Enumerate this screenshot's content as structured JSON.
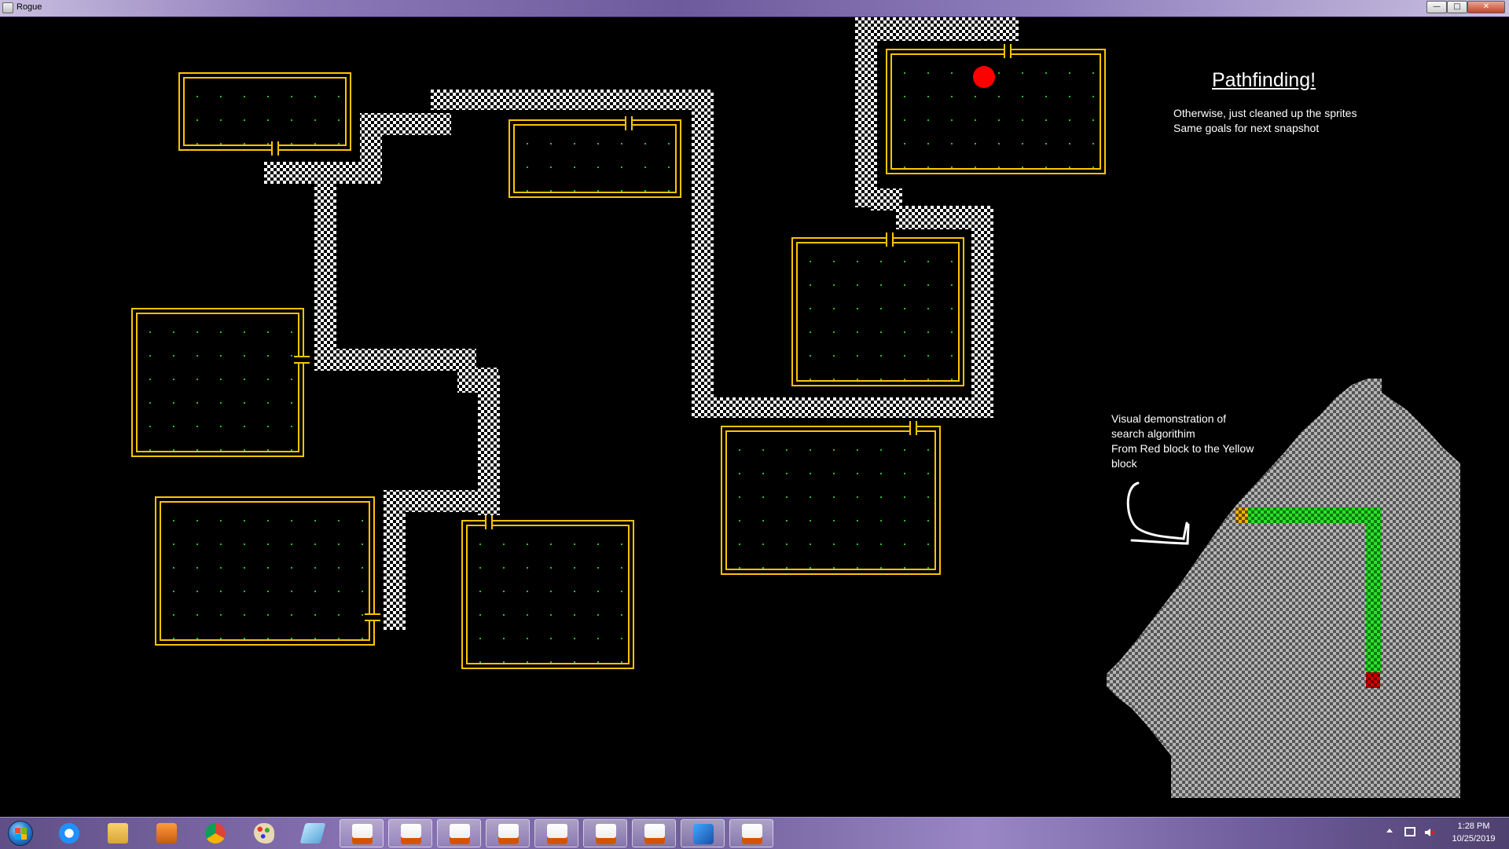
{
  "window": {
    "title": "Rogue",
    "icon": "java-window-icon"
  },
  "controls": {
    "minimize": "—",
    "maximize": "□",
    "close": "✕"
  },
  "overlay": {
    "heading": "Pathfinding!",
    "note_lines": [
      "Otherwise, just cleaned up the sprites",
      "Same goals for next snapshot"
    ],
    "visual_lines": [
      "Visual demonstration of",
      "search algorithim",
      "From Red block to the Yellow",
      "block"
    ]
  },
  "colors": {
    "room_wall": "#ffc400",
    "floor_dot": "#22c41a",
    "corridor_light": "#ffffff",
    "corridor_dark": "#000000",
    "player": "#ff0000",
    "search_path": "#22dd22",
    "search_start": "#cc0000",
    "search_goal": "#d69a00",
    "explored": "#9a9a9a"
  },
  "taskbar": {
    "start_icon": "windows-start-orb",
    "pinned": [
      {
        "name": "internet-explorer-icon"
      },
      {
        "name": "file-explorer-icon"
      },
      {
        "name": "media-player-icon"
      },
      {
        "name": "chrome-icon"
      },
      {
        "name": "paint-icon"
      },
      {
        "name": "eraser-icon"
      },
      {
        "name": "java-icon",
        "active": true
      },
      {
        "name": "java-icon",
        "active": true
      },
      {
        "name": "java-icon",
        "active": true
      },
      {
        "name": "java-icon",
        "active": true
      },
      {
        "name": "java-icon",
        "active": true
      },
      {
        "name": "java-icon",
        "active": true
      },
      {
        "name": "java-icon",
        "active": true
      },
      {
        "name": "intellij-icon",
        "active": true
      },
      {
        "name": "java-icon",
        "active": true
      }
    ],
    "tray": {
      "time": "1:28 PM",
      "date": "10/25/2019"
    }
  }
}
